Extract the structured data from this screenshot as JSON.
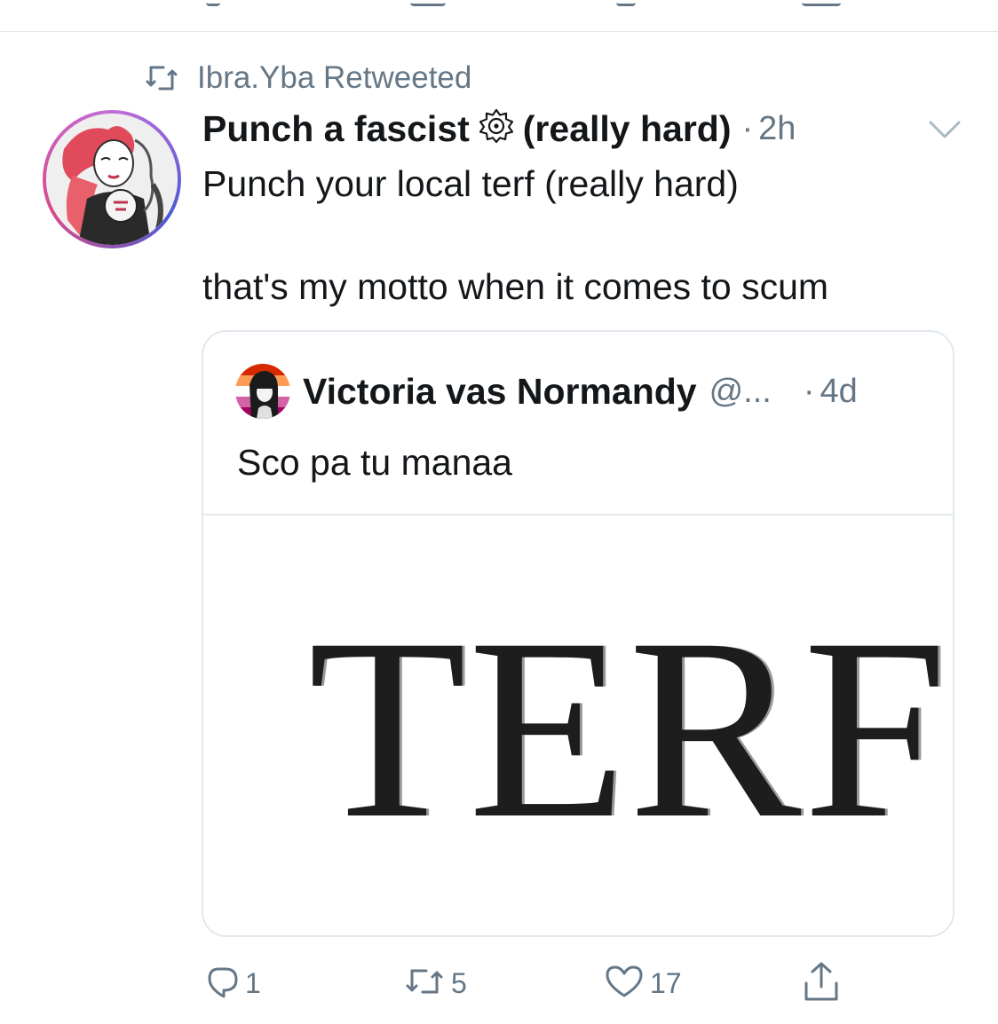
{
  "retweet_context": {
    "icon": "retweet-icon",
    "text": "Ibra.Yba Retweeted"
  },
  "tweet": {
    "display_name": "Punch a fascist",
    "display_name_suffix": "(really hard)",
    "badge_icon": "star-emblem-icon",
    "separator": "·",
    "time": "2h",
    "body_line_1": "Punch your local terf (really hard)",
    "body_line_2": "that's my motto when it comes to scum"
  },
  "quoted_tweet": {
    "display_name": "Victoria vas Normandy",
    "handle": "@...",
    "separator": "·",
    "time": "4d",
    "text": "Sco pa tu manaa",
    "image_text": "TERF"
  },
  "actions": {
    "reply_count": "1",
    "retweet_count": "5",
    "like_count": "17"
  },
  "colors": {
    "primary_text": "#14171a",
    "secondary_text": "#657786",
    "border": "#e1e8ed"
  }
}
